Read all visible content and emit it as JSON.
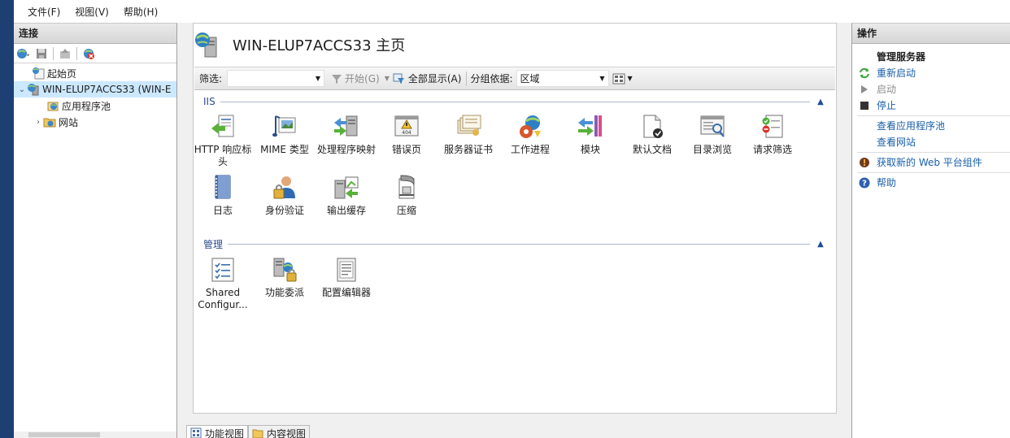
{
  "menu": {
    "file": "文件(F)",
    "view": "视图(V)",
    "help": "帮助(H)"
  },
  "connections": {
    "header": "连接",
    "tree": {
      "start_page": "起始页",
      "server": "WIN-ELUP7ACCS33 (WIN-E",
      "app_pools": "应用程序池",
      "sites": "网站"
    }
  },
  "main": {
    "title": "WIN-ELUP7ACCS33 主页",
    "filter": {
      "label": "筛选:",
      "value": "",
      "go": "开始(G)",
      "show_all": "全部显示(A)",
      "group_by_label": "分组依据:",
      "group_by_value": "区域"
    },
    "sections": [
      {
        "title": "IIS",
        "features": [
          {
            "label": "HTTP 响应标头",
            "icon": "http-response-headers-icon"
          },
          {
            "label": "MIME 类型",
            "icon": "mime-types-icon"
          },
          {
            "label": "处理程序映射",
            "icon": "handler-mappings-icon"
          },
          {
            "label": "错误页",
            "icon": "error-pages-icon"
          },
          {
            "label": "服务器证书",
            "icon": "server-certificates-icon"
          },
          {
            "label": "工作进程",
            "icon": "worker-processes-icon"
          },
          {
            "label": "模块",
            "icon": "modules-icon"
          },
          {
            "label": "默认文档",
            "icon": "default-document-icon"
          },
          {
            "label": "目录浏览",
            "icon": "directory-browsing-icon"
          },
          {
            "label": "请求筛选",
            "icon": "request-filtering-icon"
          },
          {
            "label": "日志",
            "icon": "logging-icon"
          },
          {
            "label": "身份验证",
            "icon": "authentication-icon"
          },
          {
            "label": "输出缓存",
            "icon": "output-caching-icon"
          },
          {
            "label": "压缩",
            "icon": "compression-icon"
          }
        ]
      },
      {
        "title": "管理",
        "features": [
          {
            "label": "Shared Configur...",
            "icon": "shared-configuration-icon"
          },
          {
            "label": "功能委派",
            "icon": "feature-delegation-icon"
          },
          {
            "label": "配置编辑器",
            "icon": "configuration-editor-icon"
          }
        ]
      }
    ],
    "tabs": {
      "features_view": "功能视图",
      "content_view": "内容视图"
    }
  },
  "actions": {
    "header": "操作",
    "group_title": "管理服务器",
    "restart": "重新启动",
    "start": "启动",
    "stop": "停止",
    "view_app_pools": "查看应用程序池",
    "view_sites": "查看网站",
    "get_web_platform": "获取新的 Web 平台组件",
    "help": "帮助"
  },
  "colors": {
    "link": "#1a5fa8",
    "section_title": "#2b4c8c",
    "selection": "#cce8ff"
  }
}
